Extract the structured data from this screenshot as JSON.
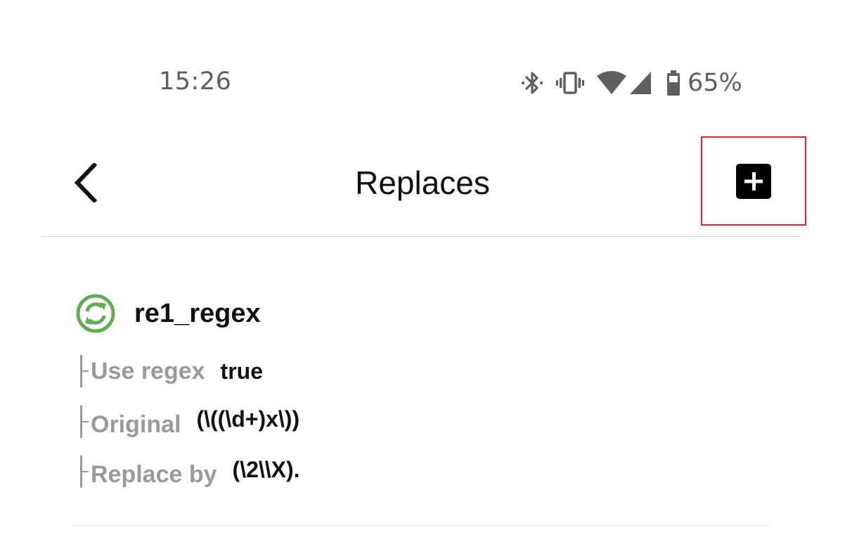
{
  "status_bar": {
    "time": "15:26",
    "battery_percent": "65%",
    "icons": [
      "bluetooth-icon",
      "vibrate-icon",
      "wifi-icon",
      "cell-signal-icon",
      "battery-icon"
    ]
  },
  "app_bar": {
    "title": "Replaces",
    "back_icon": "chevron-left-icon",
    "add_icon": "add-box-icon"
  },
  "colors": {
    "highlight_border": "#e0242b",
    "rule_icon": "#5fae52",
    "label_gray": "#9a9a9a"
  },
  "items": [
    {
      "name": "re1_regex",
      "icon": "refresh-circle-icon",
      "use_regex_label": "Use regex",
      "use_regex_value": "true",
      "original_label": "Original",
      "original_value": "(\\((\\d+)x\\))",
      "replace_by_label": "Replace by",
      "replace_by_value": "(\\2\\\\X)."
    }
  ]
}
